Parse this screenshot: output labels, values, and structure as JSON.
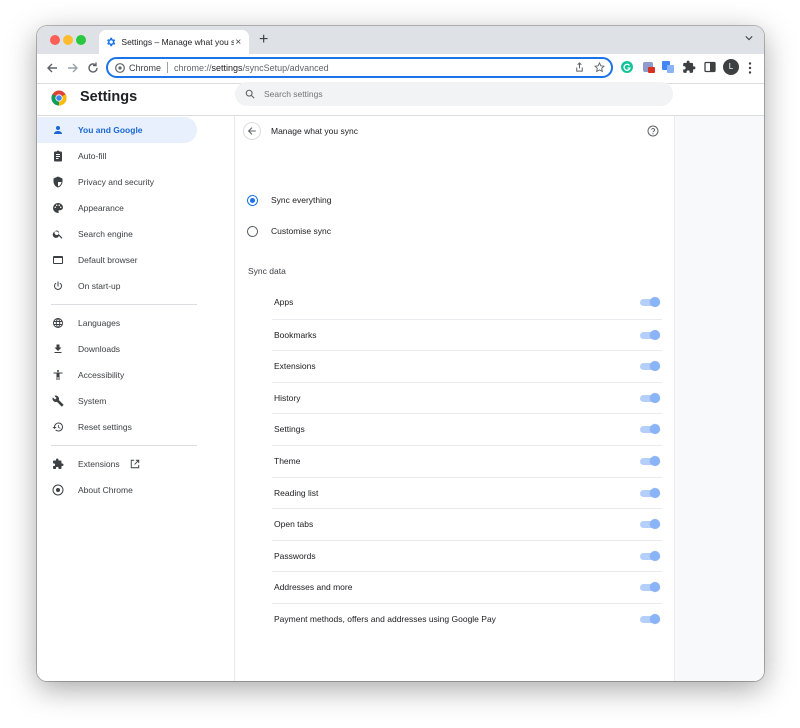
{
  "tab": {
    "title": "Settings – Manage what you sync",
    "close": "×",
    "new_tab": "+"
  },
  "omnibox": {
    "chip": "Chrome",
    "url_scheme": "chrome://",
    "url_host": "settings",
    "url_path": "/syncSetup/advanced"
  },
  "profile": {
    "initial": "L"
  },
  "header": {
    "title": "Settings",
    "search_placeholder": "Search settings"
  },
  "sidebar": {
    "items": [
      {
        "label": "You and Google",
        "icon": "person-icon",
        "active": true
      },
      {
        "label": "Auto-fill",
        "icon": "clipboard-icon"
      },
      {
        "label": "Privacy and security",
        "icon": "shield-icon"
      },
      {
        "label": "Appearance",
        "icon": "palette-icon"
      },
      {
        "label": "Search engine",
        "icon": "search-icon"
      },
      {
        "label": "Default browser",
        "icon": "browser-icon"
      },
      {
        "label": "On start-up",
        "icon": "power-icon"
      },
      {
        "label": "Languages",
        "icon": "globe-icon"
      },
      {
        "label": "Downloads",
        "icon": "download-icon"
      },
      {
        "label": "Accessibility",
        "icon": "accessibility-icon"
      },
      {
        "label": "System",
        "icon": "wrench-icon"
      },
      {
        "label": "Reset settings",
        "icon": "reset-icon"
      },
      {
        "label": "Extensions",
        "icon": "puzzle-icon"
      },
      {
        "label": "About Chrome",
        "icon": "chrome-icon"
      }
    ]
  },
  "main": {
    "title": "Manage what you sync",
    "sync_everything": "Sync everything",
    "customise_sync": "Customise sync",
    "selected_option": "Sync everything",
    "sync_data_title": "Sync data",
    "sync_items": [
      {
        "label": "Apps",
        "enabled": true
      },
      {
        "label": "Bookmarks",
        "enabled": true
      },
      {
        "label": "Extensions",
        "enabled": true
      },
      {
        "label": "History",
        "enabled": true
      },
      {
        "label": "Settings",
        "enabled": true
      },
      {
        "label": "Theme",
        "enabled": true
      },
      {
        "label": "Reading list",
        "enabled": true
      },
      {
        "label": "Open tabs",
        "enabled": true
      },
      {
        "label": "Passwords",
        "enabled": true
      },
      {
        "label": "Addresses and more",
        "enabled": true
      },
      {
        "label": "Payment methods, offers and addresses using Google Pay",
        "enabled": true
      }
    ]
  },
  "colors": {
    "accent": "#1a73e8",
    "active_bg": "#e8f0fe",
    "active_text": "#1967d2",
    "toggle_disabled": "#8ab4f8"
  }
}
